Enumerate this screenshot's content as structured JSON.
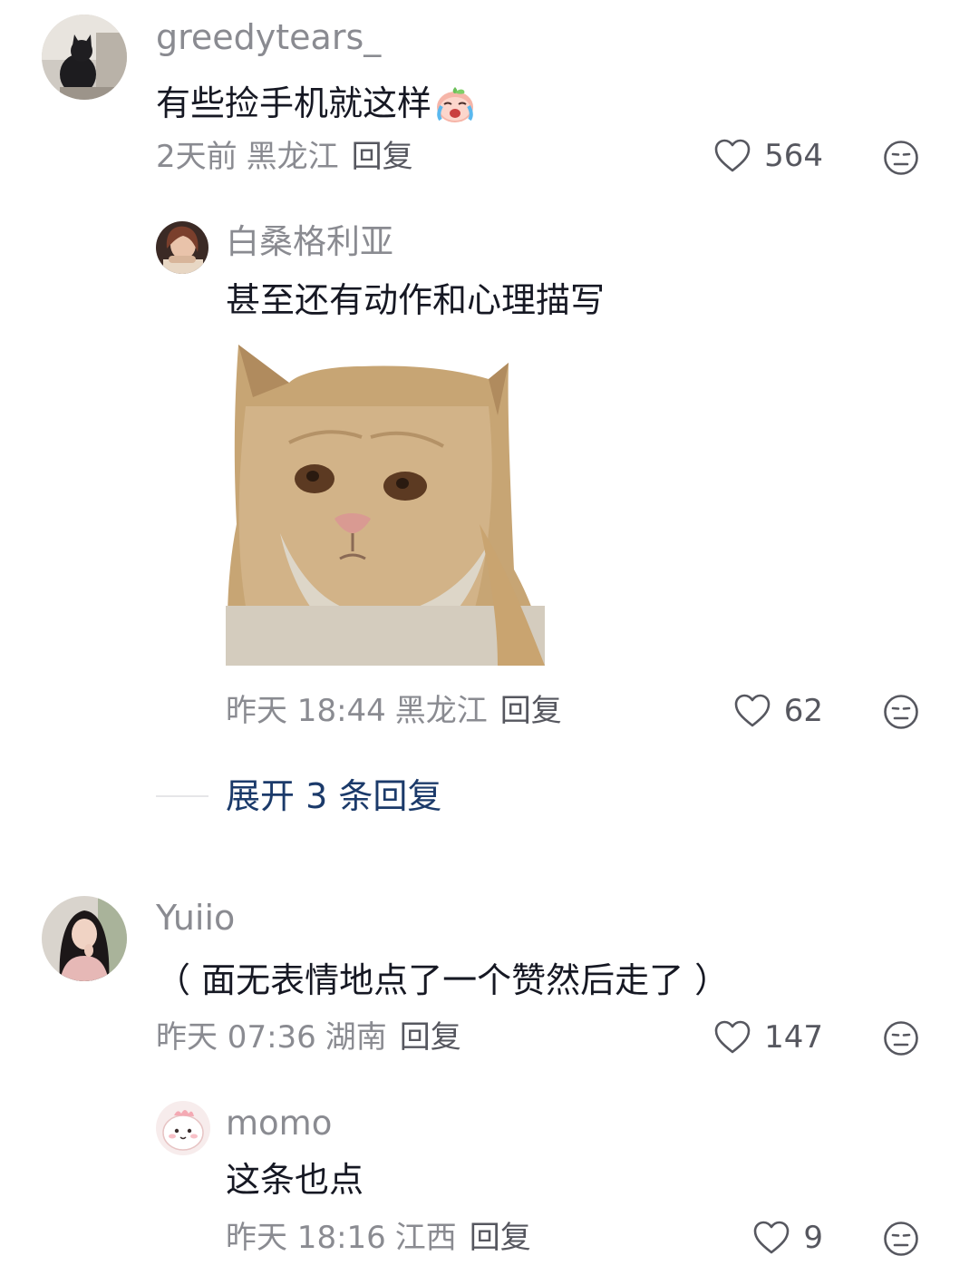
{
  "comments": [
    {
      "username": "greedytears_",
      "text": "有些捡手机就这样",
      "time": "2天前",
      "region": "黑龙江",
      "reply_label": "回复",
      "likes": "564",
      "replies": [
        {
          "username": "白桑格利亚",
          "text": "甚至还有动作和心理描写",
          "time": "昨天 18:44",
          "region": "黑龙江",
          "reply_label": "回复",
          "likes": "62"
        }
      ],
      "expand_label": "展开 3 条回复"
    },
    {
      "username": "Yuiio",
      "text": "（ 面无表情地点了一个赞然后走了 ）",
      "time": "昨天 07:36",
      "region": "湖南",
      "reply_label": "回复",
      "likes": "147",
      "replies": [
        {
          "username": "momo",
          "text": "这条也点",
          "time": "昨天 18:16",
          "region": "江西",
          "reply_label": "回复",
          "likes": "9"
        }
      ]
    }
  ],
  "icons": {
    "like": "heart-outline-icon",
    "dislike": "meh-face-icon",
    "emoji": "crying-peach-emoji"
  },
  "colors": {
    "text": "#161823",
    "muted": "#8a8b91",
    "link": "#1b3a6a"
  }
}
